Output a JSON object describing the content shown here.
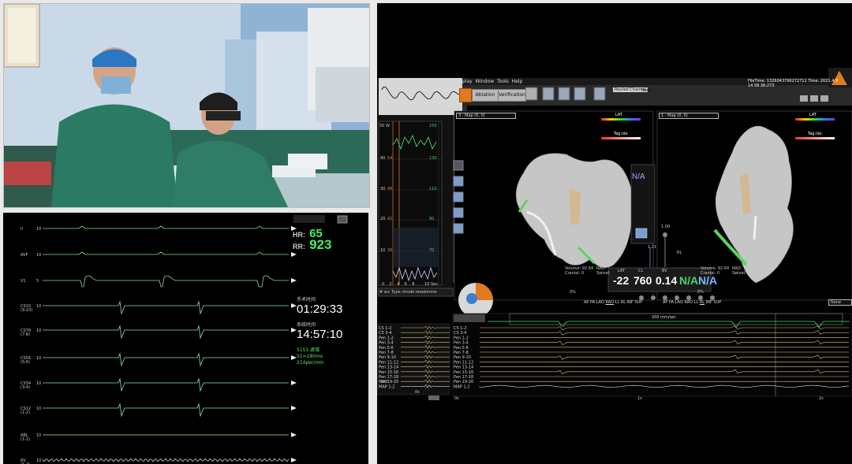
{
  "ecg_monitor": {
    "leads": [
      {
        "name": "II",
        "sub": "",
        "gain": "10"
      },
      {
        "name": "AVF",
        "sub": "",
        "gain": "10"
      },
      {
        "name": "V1",
        "sub": "",
        "gain": "5"
      },
      {
        "name": "CS10",
        "sub": "(9-10)",
        "gain": "10"
      },
      {
        "name": "CS78",
        "sub": "(7-8)",
        "gain": "10"
      },
      {
        "name": "CS56",
        "sub": "(5-6)",
        "gain": "10"
      },
      {
        "name": "CS34",
        "sub": "(3-4)",
        "gain": "10"
      },
      {
        "name": "CS12",
        "sub": "(1-2)",
        "gain": "10"
      },
      {
        "name": "ABL",
        "sub": "(1-2)",
        "gain": "10"
      },
      {
        "name": "RV",
        "sub": "(1-2)",
        "gain": "10"
      }
    ],
    "hr_label": "HR:",
    "hr_value": "65",
    "rr_label": "RR:",
    "rr_value": "923",
    "op_time_label": "手术时间",
    "op_time_value": "01:29:33",
    "sys_time_label": "系统时间",
    "sys_time_value": "14:57:10",
    "stim_lines": [
      "S1S1 递增",
      "S1=280ms",
      "214per/min"
    ]
  },
  "carto": {
    "menu": [
      "play",
      "Window",
      "Tools",
      "Help"
    ],
    "toolbar": {
      "ablation": "Ablation",
      "verification": "Verification"
    },
    "routed_channel_label": "Routed Channel",
    "routed_channel_value": "None",
    "file_info": "FileTime: 1326043790272711 Time: 2021.4.9 14.58.36.273",
    "view_left_title": "3 - Map (0, 0)",
    "view_right_title": "1 - Map (0, 0)",
    "lat_label": "LAT",
    "tag_index_label": "Tag.Idx",
    "na_label": "N/A",
    "scale_top": "1.21",
    "scale_mid": "1.00",
    "rl_label": "RL",
    "left_stats": {
      "lat_label": "LAT",
      "lat_value": "-22",
      "cl_label": "CL",
      "cl_value": "760",
      "bv_label": "BV",
      "bv_value": "0.14",
      "extra1": "N/A",
      "extra2": "N/A"
    },
    "left_meta": [
      "Volume: 92.64",
      "RAO:",
      "Cranial: 0",
      "Swivel:"
    ],
    "right_meta": [
      "Volume: 92.64",
      "RAO:",
      "Cranial: 0",
      "Swivel:"
    ],
    "view_buttons_left": [
      "AP",
      "PA",
      "LAO",
      "RAO",
      "LL",
      "RL",
      "INF",
      "SUP"
    ],
    "view_buttons_right": [
      "AP",
      "PA",
      "LAO",
      "RAO",
      "LL",
      "RL",
      "INF",
      "SUP"
    ],
    "percent_left": "0%",
    "percent_right": "0%",
    "none_select": "None",
    "strip_axis_top": "50 W",
    "strip_right_axis": [
      "150",
      "130",
      "110",
      "90",
      "70"
    ],
    "strip_left_axis": [
      "40",
      "30",
      "20",
      "10"
    ],
    "strip_values_left": [
      "54",
      "48",
      "42",
      "36"
    ],
    "strip_time_label": "10 Sec",
    "strip_time_ticks": [
      "0",
      "2",
      "4",
      "6",
      "8"
    ],
    "strip_tabs": [
      "#",
      "arc",
      "Type",
      "ctrode",
      "resebmme"
    ],
    "ecg_speed": "200 mm/sec",
    "channels": [
      "CS 1-2",
      "CS 3-4",
      "Pen 1-2",
      "Pen 3-4",
      "Pen 5-6",
      "Pen 7-8",
      "Pen 9-10",
      "Pen 11-12",
      "Pen 13-14",
      "Pen 15-16",
      "Pen 17-18",
      "Pen 19-20",
      "MAP 1-2"
    ],
    "time_ticks": [
      "0s",
      "1s",
      "2s"
    ],
    "mini_time_ticks": [
      "200",
      "0s"
    ]
  }
}
